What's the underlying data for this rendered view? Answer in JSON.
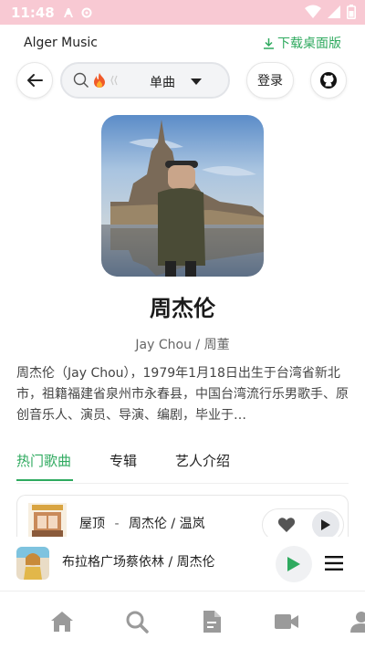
{
  "status_bar": {
    "time": "11:48"
  },
  "header": {
    "app_title": "Alger Music",
    "download_label": "下载桌面版"
  },
  "top_bar": {
    "search_type": "单曲",
    "login_label": "登录"
  },
  "artist": {
    "name": "周杰伦",
    "alias": "Jay Chou / 周董",
    "description": "周杰伦（Jay Chou），1979年1月18日出生于台湾省新北市，祖籍福建省泉州市永春县，中国台湾流行乐男歌手、原创音乐人、演员、导演、编剧，毕业于…"
  },
  "tabs": [
    {
      "label": "热门歌曲",
      "active": true
    },
    {
      "label": "专辑",
      "active": false
    },
    {
      "label": "艺人介绍",
      "active": false
    }
  ],
  "song_list": [
    {
      "title": "屋顶",
      "separator": "-",
      "artists": "周杰伦 / 温岚"
    }
  ],
  "player": {
    "now_playing": "布拉格广场蔡依林 / 周杰伦"
  },
  "bottom_nav": [
    {
      "icon": "home-icon"
    },
    {
      "icon": "search-icon"
    },
    {
      "icon": "document-icon"
    },
    {
      "icon": "video-icon"
    },
    {
      "icon": "user-icon"
    }
  ],
  "colors": {
    "accent": "#2faa5f",
    "status_bar": "#f8c9d3",
    "text": "#222222"
  }
}
